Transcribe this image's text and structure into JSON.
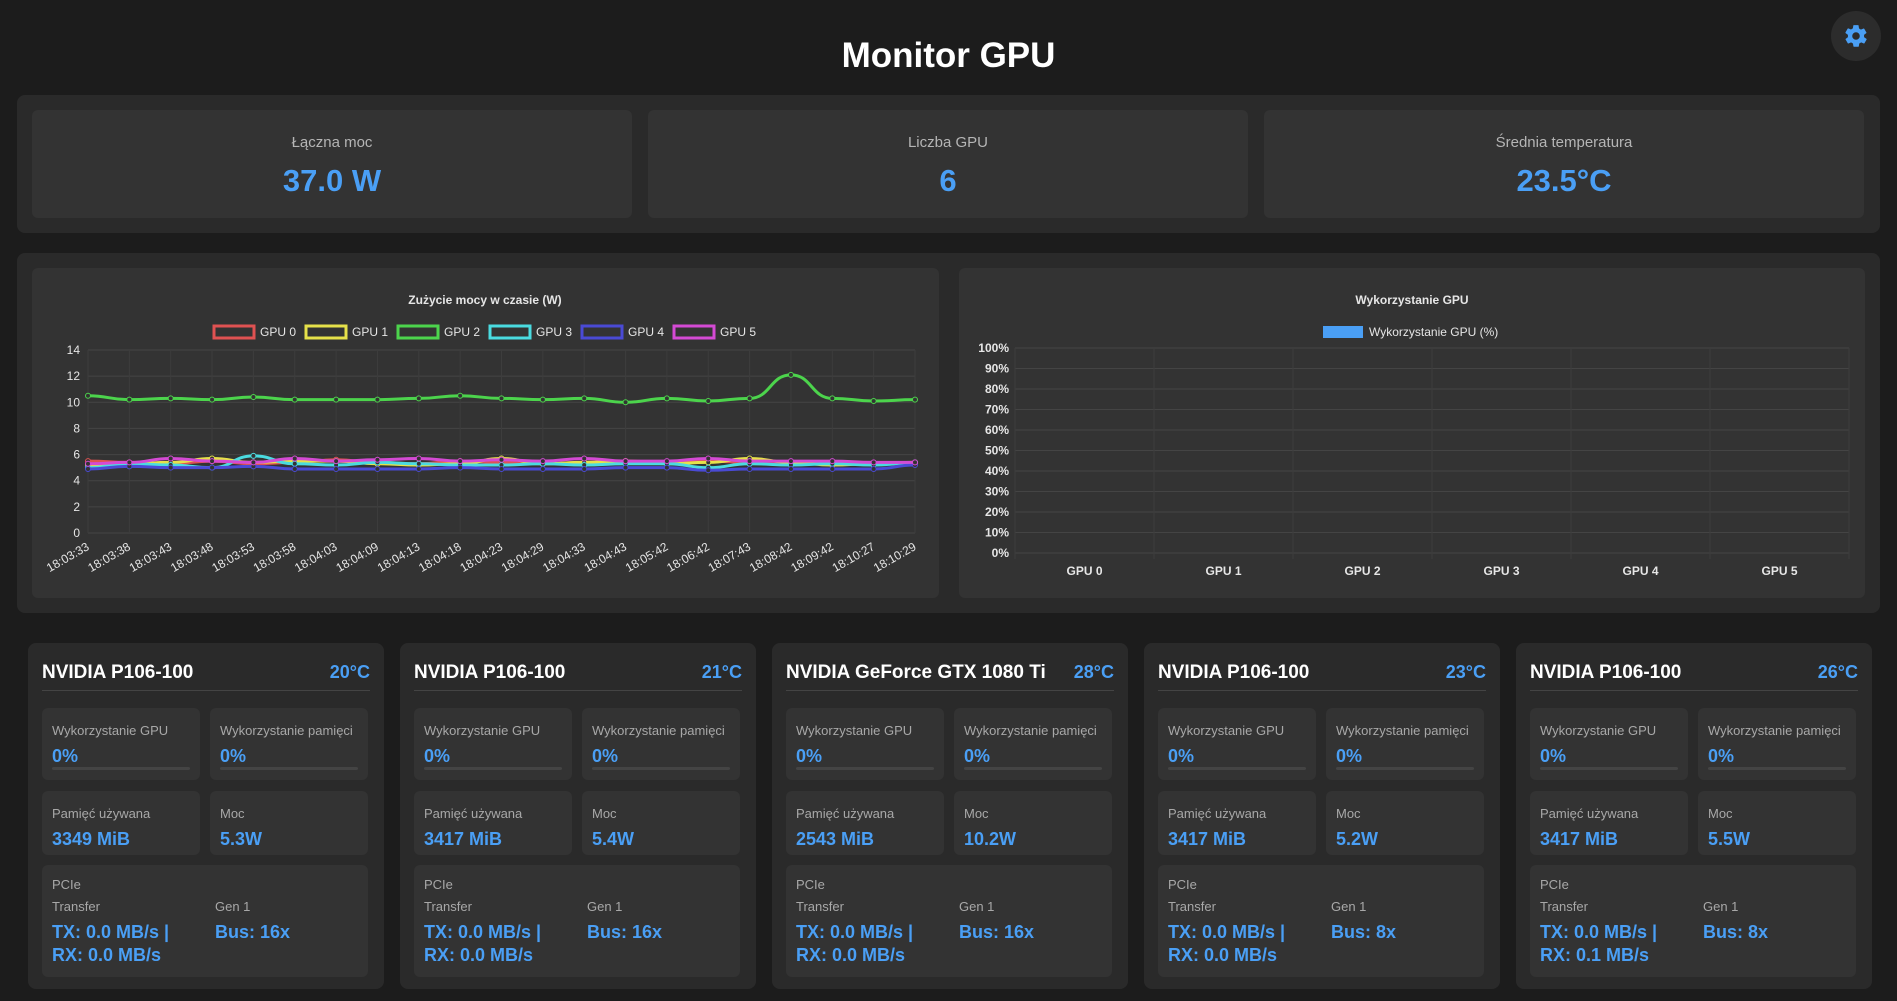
{
  "header": {
    "title": "Monitor GPU"
  },
  "icons": {
    "settings": "gear-icon"
  },
  "colors": {
    "accent": "#4a9ff5",
    "background": "#1c1c1c",
    "panel": "#2a2a2a",
    "card": "#333333"
  },
  "summary": [
    {
      "label": "Łączna moc",
      "value": "37.0 W"
    },
    {
      "label": "Liczba GPU",
      "value": "6"
    },
    {
      "label": "Średnia temperatura",
      "value": "23.5°C"
    }
  ],
  "chart_data": [
    {
      "type": "line",
      "title": "Zużycie mocy w czasie (W)",
      "ylim": [
        0,
        14
      ],
      "yticks": [
        "0",
        "2",
        "4",
        "6",
        "8",
        "10",
        "12",
        "14"
      ],
      "x": [
        "18:03:33",
        "18:03:38",
        "18:03:43",
        "18:03:48",
        "18:03:53",
        "18:03:58",
        "18:04:03",
        "18:04:09",
        "18:04:13",
        "18:04:18",
        "18:04:23",
        "18:04:29",
        "18:04:33",
        "18:04:43",
        "18:05:42",
        "18:06:42",
        "18:07:43",
        "18:08:42",
        "18:09:42",
        "18:10:27",
        "18:10:29"
      ],
      "legend_position": "top",
      "grid": true,
      "series": [
        {
          "name": "GPU 0",
          "color": "#e05252",
          "values": [
            5.5,
            5.4,
            5.3,
            5.5,
            5.3,
            5.4,
            5.6,
            5.4,
            5.3,
            5.5,
            5.4,
            5.3,
            5.4,
            5.5,
            5.4,
            5.5,
            5.4,
            5.3,
            5.4,
            5.3,
            5.3
          ]
        },
        {
          "name": "GPU 1",
          "color": "#e6e14a",
          "values": [
            5.2,
            5.3,
            5.4,
            5.7,
            5.4,
            5.5,
            5.5,
            5.3,
            5.2,
            5.3,
            5.7,
            5.3,
            5.4,
            5.5,
            5.3,
            5.4,
            5.7,
            5.4,
            5.2,
            5.3,
            5.4
          ]
        },
        {
          "name": "GPU 2",
          "color": "#4cd44c",
          "values": [
            10.5,
            10.2,
            10.3,
            10.2,
            10.4,
            10.2,
            10.2,
            10.2,
            10.3,
            10.5,
            10.3,
            10.2,
            10.3,
            10.0,
            10.3,
            10.1,
            10.3,
            12.1,
            10.3,
            10.1,
            10.2
          ]
        },
        {
          "name": "GPU 3",
          "color": "#4adbe0",
          "values": [
            5.0,
            5.3,
            5.2,
            5.0,
            5.9,
            5.3,
            5.2,
            5.4,
            5.3,
            5.2,
            5.2,
            5.3,
            5.2,
            5.3,
            5.3,
            5.0,
            5.3,
            5.2,
            5.3,
            5.2,
            5.4
          ]
        },
        {
          "name": "GPU 4",
          "color": "#4a4ad4",
          "values": [
            4.9,
            5.1,
            5.0,
            5.0,
            5.1,
            4.9,
            4.9,
            4.9,
            4.9,
            5.0,
            4.9,
            4.9,
            4.9,
            5.0,
            5.0,
            4.8,
            4.9,
            4.9,
            4.9,
            4.9,
            5.2
          ]
        },
        {
          "name": "GPU 5",
          "color": "#d44ad4",
          "values": [
            5.3,
            5.4,
            5.7,
            5.5,
            5.4,
            5.7,
            5.5,
            5.6,
            5.7,
            5.5,
            5.6,
            5.5,
            5.7,
            5.5,
            5.5,
            5.7,
            5.5,
            5.5,
            5.5,
            5.4,
            5.4
          ]
        }
      ]
    },
    {
      "type": "bar",
      "title": "Wykorzystanie GPU",
      "categories": [
        "GPU 0",
        "GPU 1",
        "GPU 2",
        "GPU 3",
        "GPU 4",
        "GPU 5"
      ],
      "ylim": [
        0,
        100
      ],
      "yticks": [
        "0%",
        "10%",
        "20%",
        "30%",
        "40%",
        "50%",
        "60%",
        "70%",
        "80%",
        "90%",
        "100%"
      ],
      "legend_position": "top",
      "grid": true,
      "series": [
        {
          "name": "Wykorzystanie GPU (%)",
          "color": "#4a9ff5",
          "values": [
            0,
            0,
            0,
            0,
            0,
            0
          ]
        }
      ]
    }
  ],
  "labels": {
    "gpu_util": "Wykorzystanie GPU",
    "mem_util": "Wykorzystanie pamięci",
    "mem_used": "Pamięć używana",
    "power": "Moc",
    "pcie": "PCIe",
    "transfer": "Transfer"
  },
  "gpus": [
    {
      "name": "NVIDIA P106-100",
      "temp": "20°C",
      "gpu_util": "0%",
      "gpu_util_frac": 0,
      "mem_util": "0%",
      "mem_util_frac": 0,
      "mem_used": "3349 MiB",
      "power": "5.3W",
      "gen": "Gen 1",
      "tx": "TX: 0.0 MB/s |",
      "rx": "RX: 0.0 MB/s",
      "bus": "Bus: 16x"
    },
    {
      "name": "NVIDIA P106-100",
      "temp": "21°C",
      "gpu_util": "0%",
      "gpu_util_frac": 0,
      "mem_util": "0%",
      "mem_util_frac": 0,
      "mem_used": "3417 MiB",
      "power": "5.4W",
      "gen": "Gen 1",
      "tx": "TX: 0.0 MB/s |",
      "rx": "RX: 0.0 MB/s",
      "bus": "Bus: 16x"
    },
    {
      "name": "NVIDIA GeForce GTX 1080 Ti",
      "temp": "28°C",
      "gpu_util": "0%",
      "gpu_util_frac": 0,
      "mem_util": "0%",
      "mem_util_frac": 0,
      "mem_used": "2543 MiB",
      "power": "10.2W",
      "gen": "Gen 1",
      "tx": "TX: 0.0 MB/s |",
      "rx": "RX: 0.0 MB/s",
      "bus": "Bus: 16x"
    },
    {
      "name": "NVIDIA P106-100",
      "temp": "23°C",
      "gpu_util": "0%",
      "gpu_util_frac": 0,
      "mem_util": "0%",
      "mem_util_frac": 0,
      "mem_used": "3417 MiB",
      "power": "5.2W",
      "gen": "Gen 1",
      "tx": "TX: 0.0 MB/s |",
      "rx": "RX: 0.0 MB/s",
      "bus": "Bus: 8x"
    },
    {
      "name": "NVIDIA P106-100",
      "temp": "26°C",
      "gpu_util": "0%",
      "gpu_util_frac": 0,
      "mem_util": "0%",
      "mem_util_frac": 0,
      "mem_used": "3417 MiB",
      "power": "5.5W",
      "gen": "Gen 1",
      "tx": "TX: 0.0 MB/s |",
      "rx": "RX: 0.1 MB/s",
      "bus": "Bus: 8x"
    }
  ]
}
